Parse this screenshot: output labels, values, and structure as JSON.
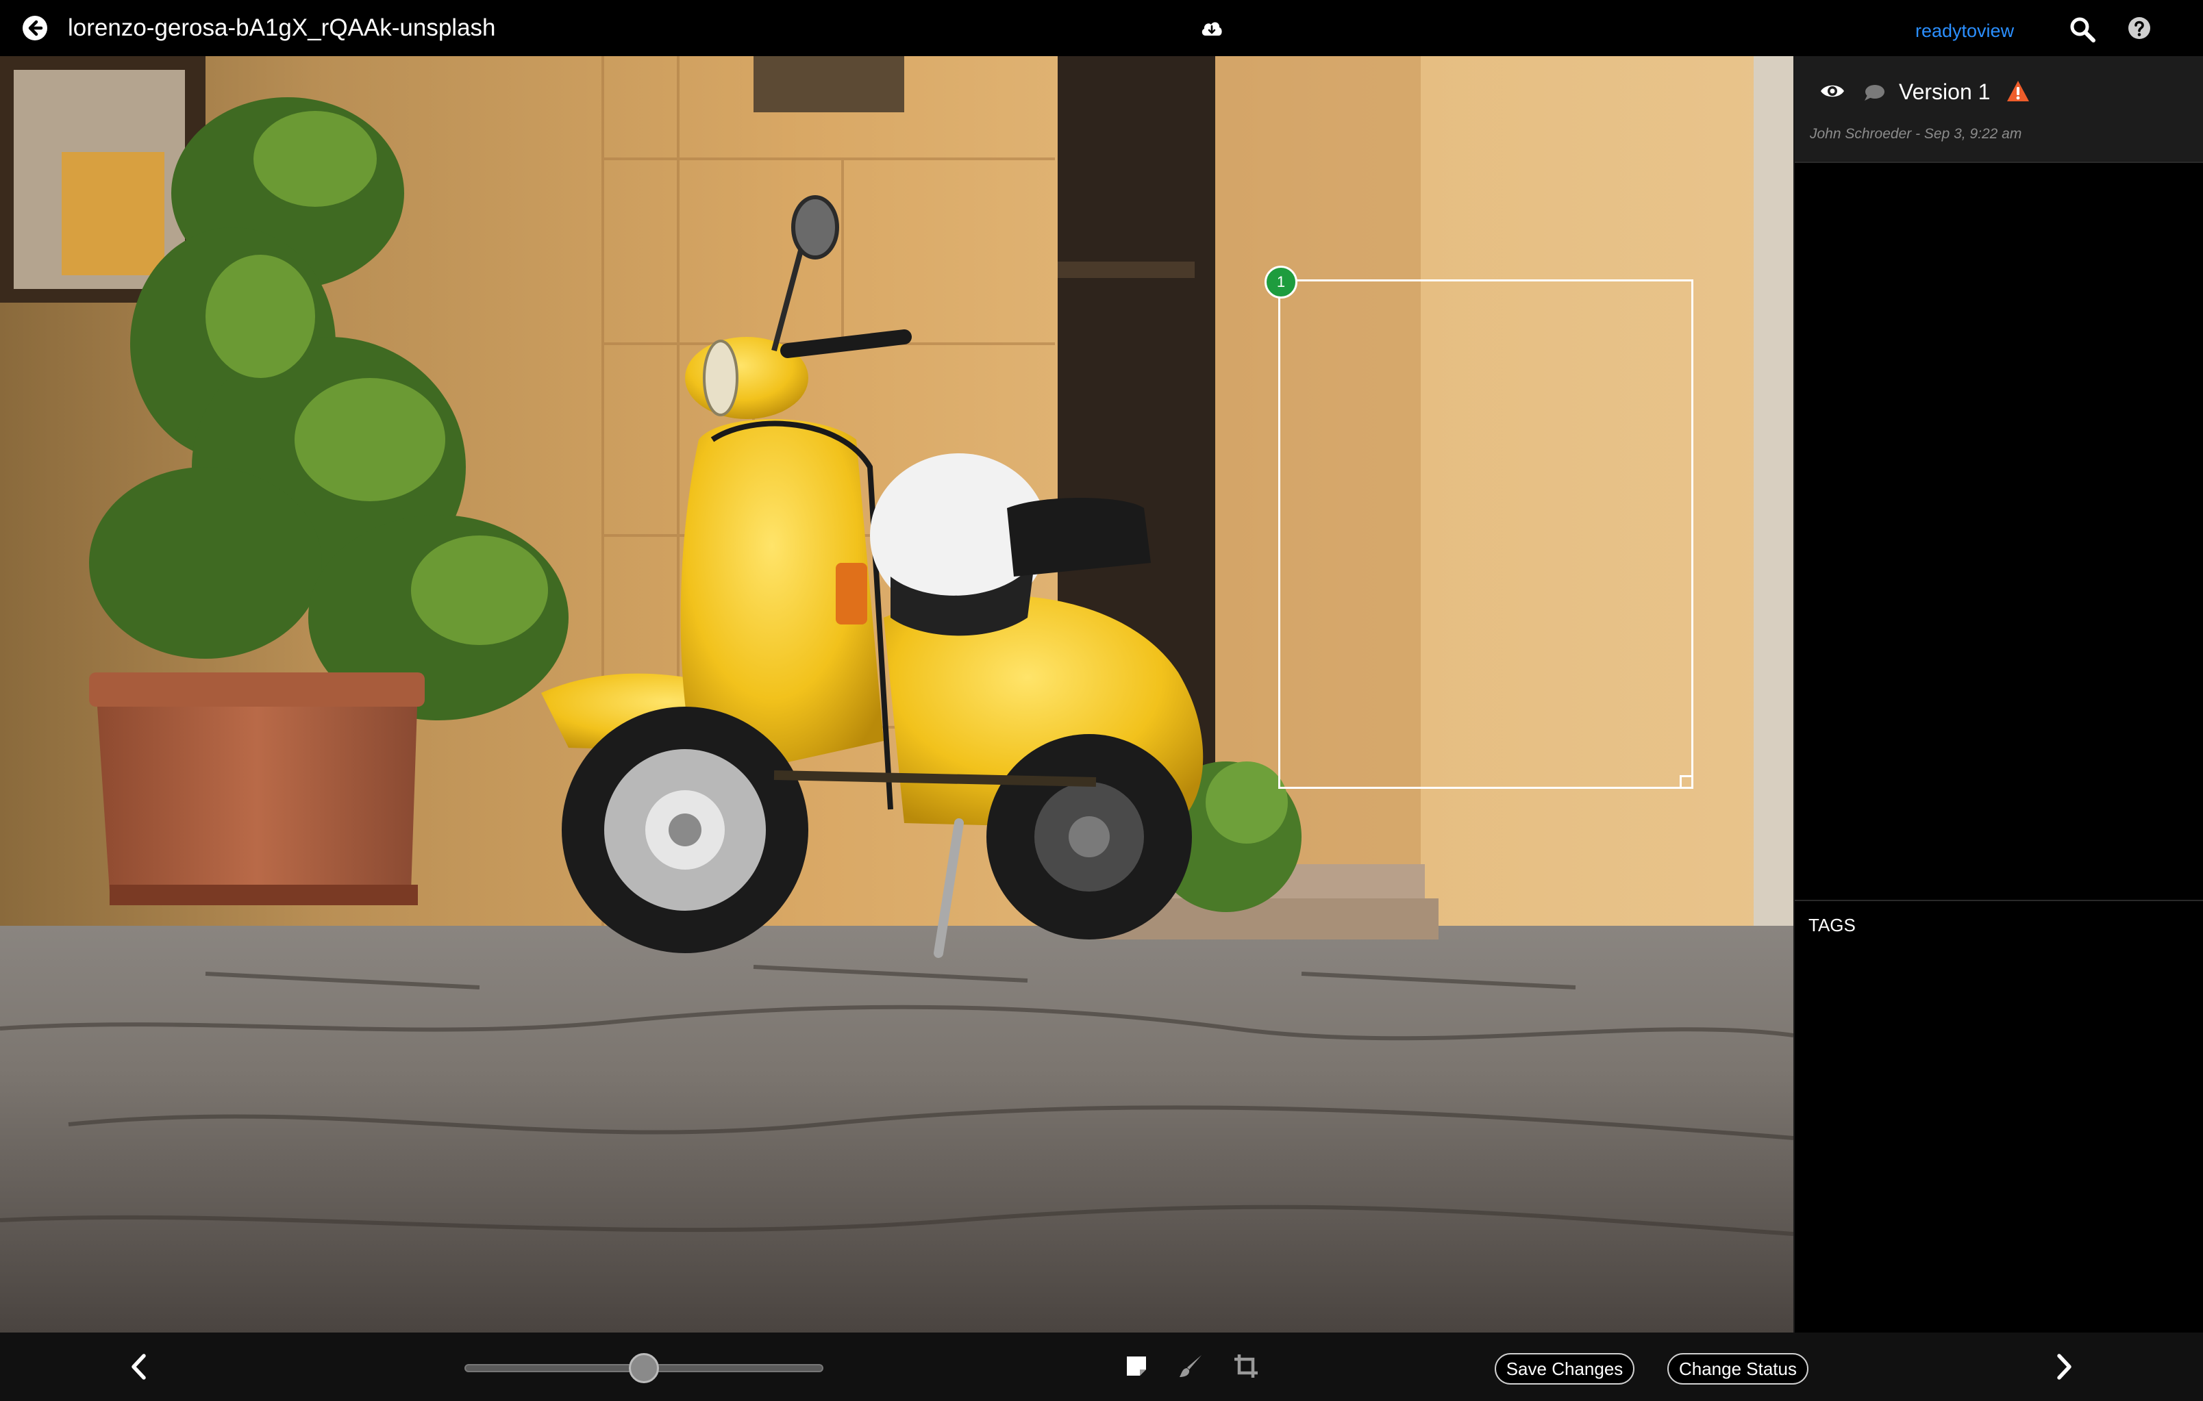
{
  "header": {
    "file_title": "lorenzo-gerosa-bA1gX_rQAAk-unsplash",
    "status_link": "readytoview",
    "icons": [
      "back-arrow-icon",
      "cloud-download-icon",
      "search-icon",
      "help-icon"
    ]
  },
  "annotation": {
    "number": "1",
    "marker_color": "#1e9c3e"
  },
  "side_panel": {
    "version_label": "Version 1",
    "version_meta": "John Schroeder - Sep 3, 9:22 am",
    "tags_heading": "TAGS",
    "warning_color": "#ee5d2b",
    "icons": [
      "eye-icon",
      "comment-icon",
      "warning-icon"
    ]
  },
  "toolbar": {
    "zoom_level": 0.5,
    "save_label": "Save Changes",
    "status_label": "Change Status",
    "icons": [
      "chevron-left-icon",
      "note-icon",
      "brush-icon",
      "crop-icon",
      "chevron-right-icon"
    ]
  },
  "colors": {
    "link": "#2b8fff",
    "panel_bg": "#1c1c1c"
  }
}
